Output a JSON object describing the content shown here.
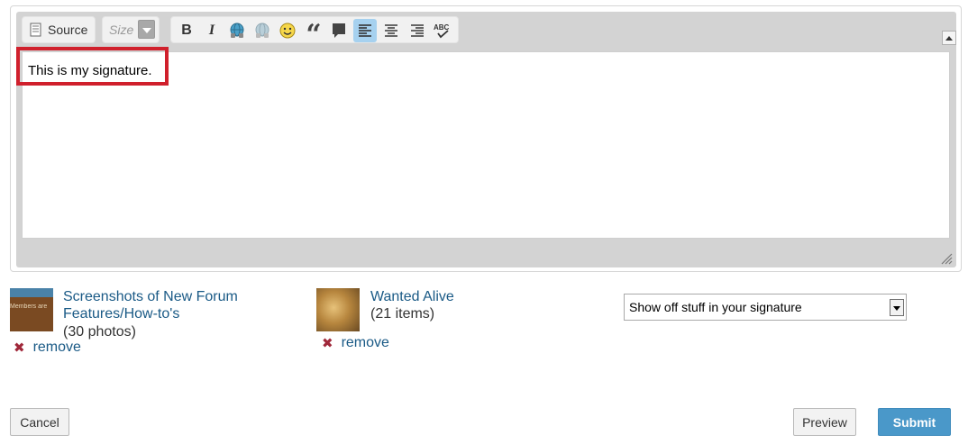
{
  "toolbar": {
    "source_label": "Source",
    "size_label": "Size",
    "buttons": [
      "bold",
      "italic",
      "insert-link",
      "unlink",
      "smiley",
      "blockquote",
      "spoiler",
      "align-left",
      "align-center",
      "align-right",
      "spellcheck"
    ],
    "active_button": "align-left",
    "bold_glyph": "B",
    "italic_glyph": "I",
    "quote_glyph": "“",
    "spell_glyph": "ABC"
  },
  "editor": {
    "content": "This is my signature."
  },
  "attachments": [
    {
      "title_line1": "Screenshots of New Forum",
      "title_line2": "Features/How-to's",
      "count": "(30 photos)",
      "thumb_text": "Members are",
      "remove_label": "remove"
    },
    {
      "title_line1": "Wanted Alive",
      "count": "(21 items)",
      "remove_label": "remove"
    }
  ],
  "signature_select": {
    "value": "Show off stuff in your signature"
  },
  "actions": {
    "cancel": "Cancel",
    "preview": "Preview",
    "submit": "Submit"
  },
  "colors": {
    "link": "#1a5a86",
    "submit_bg": "#4a98c9",
    "highlight": "#d0202c",
    "remove_x": "#a0283a"
  }
}
